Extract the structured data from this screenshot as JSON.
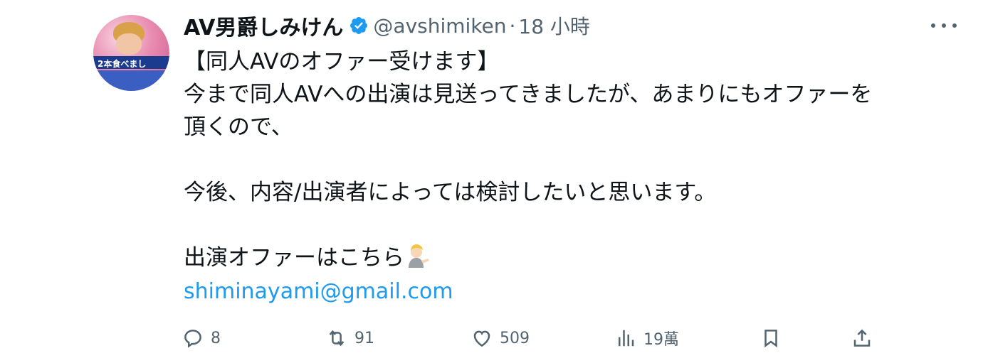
{
  "author": {
    "display_name": "AV男爵しみけん",
    "handle": "@avshimiken",
    "separator": "·",
    "time": "18 小時",
    "avatar_caption": "2本食べまし"
  },
  "tweet": {
    "lines": [
      "【同人AVのオファー受けます】",
      "今まで同人AVへの出演は見送ってきましたが、あまりにもオファーを",
      "頂くので、",
      "",
      "今後、内容/出演者によっては検討したいと思います。",
      "",
      "出演オファーはこちら"
    ],
    "link": "shiminayami@gmail.com"
  },
  "actions": {
    "reply_count": "8",
    "retweet_count": "91",
    "like_count": "509",
    "views_count": "19萬"
  },
  "colors": {
    "text": "#0f1419",
    "secondary": "#536471",
    "link": "#1d9bf0",
    "verified": "#1d9bf0"
  },
  "icons": [
    "verified-badge-icon",
    "more-icon",
    "reply-icon",
    "retweet-icon",
    "like-icon",
    "views-icon",
    "bookmark-icon",
    "share-icon",
    "person-tipping-hand-emoji"
  ]
}
